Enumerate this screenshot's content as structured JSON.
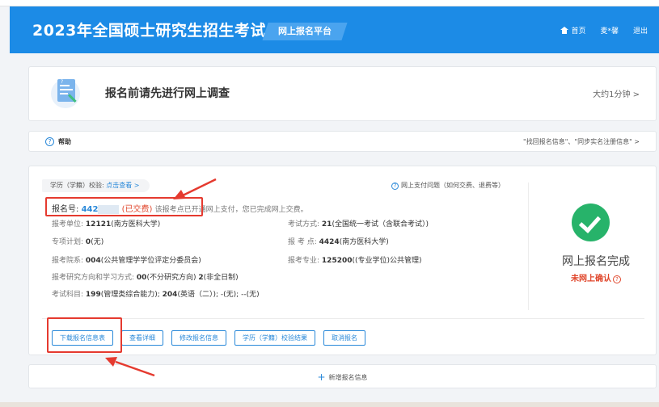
{
  "header": {
    "title": "2023年全国硕士研究生招生考试",
    "badge": "网上报名平台",
    "nav": {
      "home": "首页",
      "user": "麦*馨",
      "logout": "退出"
    }
  },
  "survey": {
    "title": "报名前请先进行网上调查",
    "time": "大约1分钟 >"
  },
  "help": {
    "label": "帮助",
    "links": "\"找回报名信息\"、\"同步实名注册信息\" >"
  },
  "registration": {
    "verify_label": "学历（学籍）校验:",
    "verify_link": "点击查看 >",
    "pay_help": "网上支付问题（如何交费、退费等）",
    "reg_label": "报名号:",
    "reg_no": "442",
    "paid": "(已交费)",
    "paid_note": "该报考点已开通网上支付，您已完成网上交费。",
    "unit_label": "报考单位:",
    "unit_code": "12121",
    "unit_name": "(南方医科大学)",
    "method_label": "考试方式:",
    "method_code": "21",
    "method_name": "(全国统一考试（含联合考试）)",
    "plan_label": "专项计划:",
    "plan_code": "0",
    "plan_name": "(无)",
    "site_label": "报 考 点:",
    "site_code": "4424",
    "site_name": "(南方医科大学)",
    "dept_label": "报考院系:",
    "dept_code": "004",
    "dept_name": "(公共管理学学位评定分委员会)",
    "major_label": "报考专业:",
    "major_code": "125200",
    "major_name": "((专业学位)公共管理)",
    "direction_label": "报考研究方向和学习方式:",
    "direction_code": "00",
    "direction_name": "(不分研究方向)",
    "study_code": "2",
    "study_name": "(非全日制)",
    "subjects_label": "考试科目:",
    "s1_code": "199",
    "s1_name": "(管理类综合能力);",
    "s2_code": "204",
    "s2_name": "(英语（二）);",
    "s3": "-(无);",
    "s4": "--(无)"
  },
  "status": {
    "title": "网上报名完成",
    "sub": "未网上确认"
  },
  "buttons": {
    "download": "下载报名信息表",
    "details": "查看详细",
    "modify": "修改报名信息",
    "verify_result": "学历（学籍）校验结果",
    "cancel": "取消报名"
  },
  "newreg": {
    "label": "新增报名信息"
  },
  "colors": {
    "header_blue": "#1c8be6",
    "link_blue": "#2a89d9",
    "success_green": "#27b36a",
    "alert_red": "#e0462b",
    "annotation_red": "#e53a2f"
  }
}
